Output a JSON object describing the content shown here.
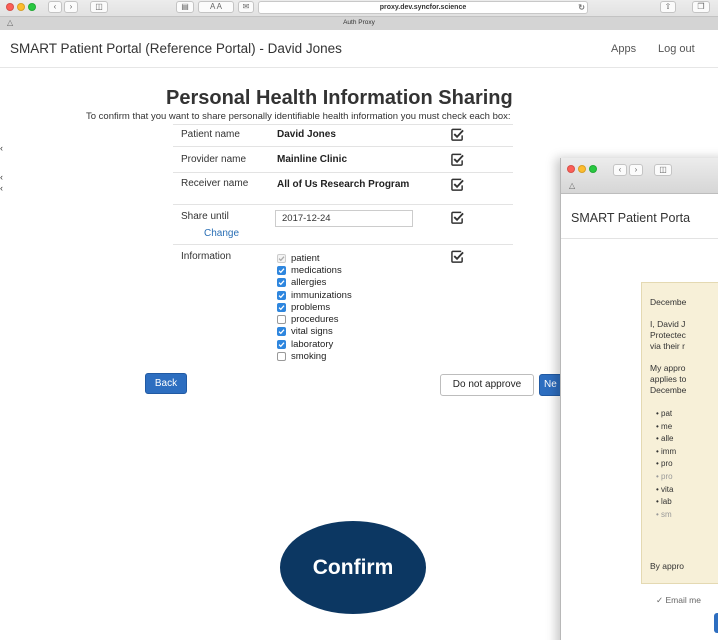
{
  "browser": {
    "url": "proxy.dev.syncfor.science",
    "tab_title": "Auth Proxy",
    "aa_label": "A A"
  },
  "header": {
    "title": "SMART Patient Portal (Reference Portal) - David Jones",
    "nav": {
      "apps": "Apps",
      "logout": "Log out"
    }
  },
  "form": {
    "heading": "Personal Health Information Sharing",
    "intro": "To confirm that you want to share personally identifiable health information you must check each box:",
    "rows": [
      {
        "label": "Patient name",
        "value": "David Jones"
      },
      {
        "label": "Provider name",
        "value": "Mainline Clinic"
      },
      {
        "label": "Receiver name",
        "value": "All of Us Research Program"
      },
      {
        "label": "Share until",
        "value": "2017-12-24",
        "action": "Change"
      },
      {
        "label": "Information"
      }
    ],
    "information": [
      {
        "label": "patient",
        "state": "disabled-checked"
      },
      {
        "label": "medications",
        "state": "checked"
      },
      {
        "label": "allergies",
        "state": "checked"
      },
      {
        "label": "immunizations",
        "state": "checked"
      },
      {
        "label": "problems",
        "state": "checked"
      },
      {
        "label": "procedures",
        "state": "unchecked"
      },
      {
        "label": "vital signs",
        "state": "checked"
      },
      {
        "label": "laboratory",
        "state": "checked"
      },
      {
        "label": "smoking",
        "state": "unchecked"
      }
    ],
    "buttons": {
      "back": "Back",
      "deny": "Do not approve",
      "next": "Ne"
    }
  },
  "confirm_label": "Confirm",
  "overlay_window": {
    "title": "SMART Patient Porta",
    "consent_lines": [
      "Decembe",
      "I, David J",
      "Protectec",
      "via their r",
      "My appro",
      "applies to",
      "Decembe"
    ],
    "bullets": [
      "pat",
      "me",
      "alle",
      "imm",
      "pro",
      "pro",
      "vita",
      "lab",
      "sm"
    ],
    "closing": "By appro",
    "email": "Email me"
  },
  "colors": {
    "primary": "#2d6ec0",
    "confirm_bg": "#0c3762",
    "consent_bg": "#f7f0d8"
  }
}
